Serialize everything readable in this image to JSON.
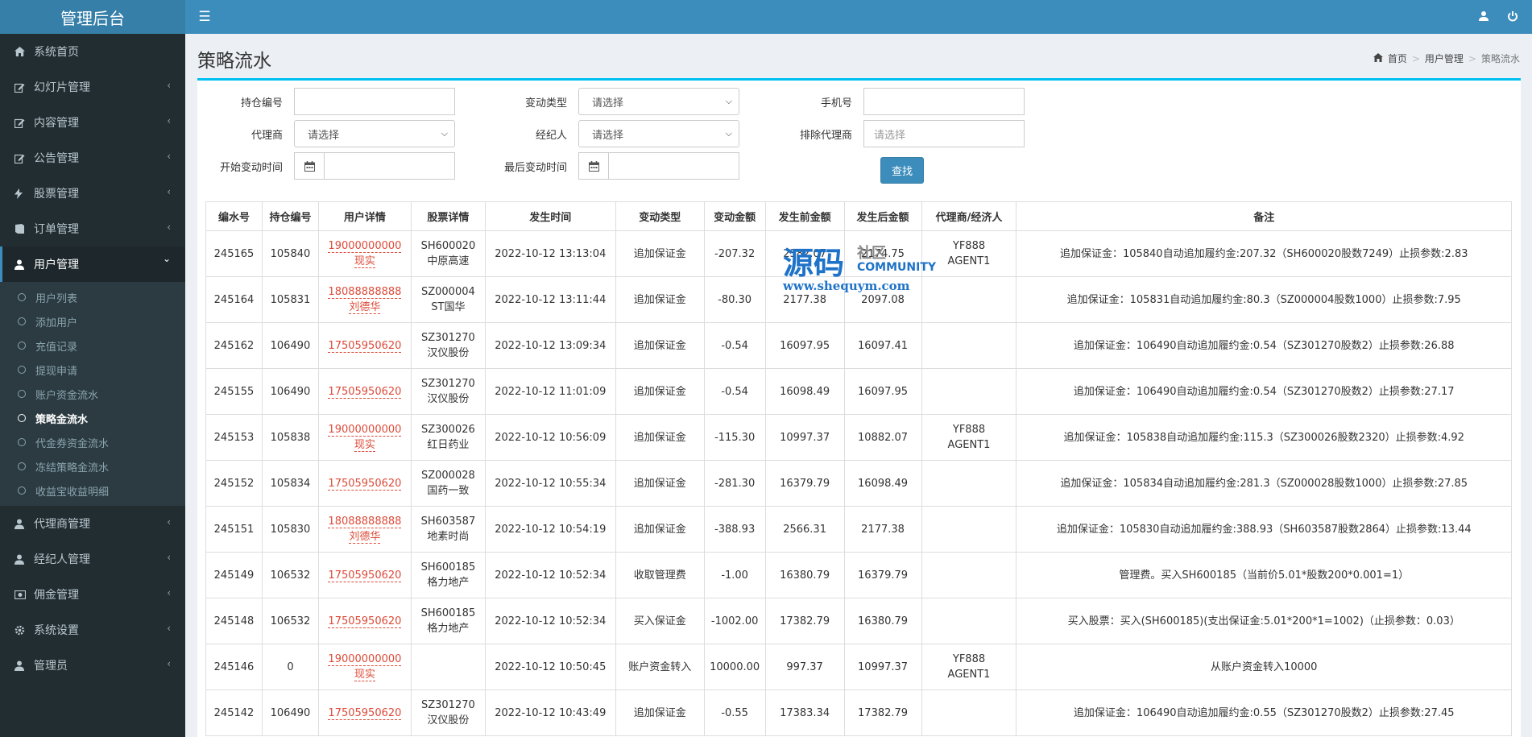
{
  "app": {
    "title": "管理后台"
  },
  "header": {
    "toggle_icon": "menu-icon",
    "user_icon": "user-icon",
    "power_icon": "power-icon"
  },
  "sidebar": {
    "items": [
      {
        "label": "系统首页",
        "icon": "home-icon",
        "has_arrow": false
      },
      {
        "label": "幻灯片管理",
        "icon": "edit-icon",
        "has_arrow": true
      },
      {
        "label": "内容管理",
        "icon": "edit-icon",
        "has_arrow": true
      },
      {
        "label": "公告管理",
        "icon": "edit-icon",
        "has_arrow": true
      },
      {
        "label": "股票管理",
        "icon": "bolt-icon",
        "has_arrow": true
      },
      {
        "label": "订单管理",
        "icon": "book-icon",
        "has_arrow": true
      },
      {
        "label": "用户管理",
        "icon": "user-icon",
        "has_arrow": true,
        "active": true
      },
      {
        "label": "代理商管理",
        "icon": "user-icon",
        "has_arrow": true
      },
      {
        "label": "经纪人管理",
        "icon": "user-icon",
        "has_arrow": true
      },
      {
        "label": "佣金管理",
        "icon": "money-icon",
        "has_arrow": true
      },
      {
        "label": "系统设置",
        "icon": "gear-icon",
        "has_arrow": true
      },
      {
        "label": "管理员",
        "icon": "user-icon",
        "has_arrow": true
      }
    ],
    "user_submenu": [
      {
        "label": "用户列表"
      },
      {
        "label": "添加用户"
      },
      {
        "label": "充值记录"
      },
      {
        "label": "提现申请"
      },
      {
        "label": "账户资金流水"
      },
      {
        "label": "策略金流水",
        "active": true
      },
      {
        "label": "代金券资金流水"
      },
      {
        "label": "冻结策略金流水"
      },
      {
        "label": "收益宝收益明细"
      }
    ]
  },
  "page": {
    "title": "策略流水",
    "breadcrumb": [
      "首页",
      "用户管理",
      "策略流水"
    ]
  },
  "filters": {
    "position_no_label": "持仓编号",
    "change_type_label": "变动类型",
    "change_type_value": "请选择",
    "phone_label": "手机号",
    "agent_label": "代理商",
    "agent_value": "请选择",
    "broker_label": "经纪人",
    "broker_value": "请选择",
    "exclude_agent_label": "排除代理商",
    "exclude_agent_placeholder": "请选择",
    "start_time_label": "开始变动时间",
    "end_time_label": "最后变动时间",
    "search_button": "查找"
  },
  "table": {
    "headers": [
      "编水号",
      "持仓编号",
      "用户详情",
      "股票详情",
      "发生时间",
      "变动类型",
      "变动金额",
      "发生前金额",
      "发生后金额",
      "代理商/经济人",
      "备注"
    ],
    "rows": [
      {
        "id": "245165",
        "pos": "105840",
        "phone": "19000000000",
        "name": "现实",
        "code": "SH600020",
        "stock": "中原高速",
        "time": "2022-10-12 13:13:04",
        "type": "追加保证金",
        "amount": "-207.32",
        "before": "2382.07",
        "after": "2174.75",
        "agent": "YF888",
        "broker": "AGENT1",
        "note": "追加保证金：105840自动追加履约金:207.32（SH600020股数7249）止损参数:2.83"
      },
      {
        "id": "245164",
        "pos": "105831",
        "phone": "18088888888",
        "name": "刘德华",
        "code": "SZ000004",
        "stock": "ST国华",
        "time": "2022-10-12 13:11:44",
        "type": "追加保证金",
        "amount": "-80.30",
        "before": "2177.38",
        "after": "2097.08",
        "agent": "",
        "broker": "",
        "note": "追加保证金：105831自动追加履约金:80.3（SZ000004股数1000）止损参数:7.95"
      },
      {
        "id": "245162",
        "pos": "106490",
        "phone": "17505950620",
        "name": "",
        "code": "SZ301270",
        "stock": "汉仪股份",
        "time": "2022-10-12 13:09:34",
        "type": "追加保证金",
        "amount": "-0.54",
        "before": "16097.95",
        "after": "16097.41",
        "agent": "",
        "broker": "",
        "note": "追加保证金：106490自动追加履约金:0.54（SZ301270股数2）止损参数:26.88"
      },
      {
        "id": "245155",
        "pos": "106490",
        "phone": "17505950620",
        "name": "",
        "code": "SZ301270",
        "stock": "汉仪股份",
        "time": "2022-10-12 11:01:09",
        "type": "追加保证金",
        "amount": "-0.54",
        "before": "16098.49",
        "after": "16097.95",
        "agent": "",
        "broker": "",
        "note": "追加保证金：106490自动追加履约金:0.54（SZ301270股数2）止损参数:27.17"
      },
      {
        "id": "245153",
        "pos": "105838",
        "phone": "19000000000",
        "name": "现实",
        "code": "SZ300026",
        "stock": "红日药业",
        "time": "2022-10-12 10:56:09",
        "type": "追加保证金",
        "amount": "-115.30",
        "before": "10997.37",
        "after": "10882.07",
        "agent": "YF888",
        "broker": "AGENT1",
        "note": "追加保证金：105838自动追加履约金:115.3（SZ300026股数2320）止损参数:4.92"
      },
      {
        "id": "245152",
        "pos": "105834",
        "phone": "17505950620",
        "name": "",
        "code": "SZ000028",
        "stock": "国药一致",
        "time": "2022-10-12 10:55:34",
        "type": "追加保证金",
        "amount": "-281.30",
        "before": "16379.79",
        "after": "16098.49",
        "agent": "",
        "broker": "",
        "note": "追加保证金：105834自动追加履约金:281.3（SZ000028股数1000）止损参数:27.85"
      },
      {
        "id": "245151",
        "pos": "105830",
        "phone": "18088888888",
        "name": "刘德华",
        "code": "SH603587",
        "stock": "地素时尚",
        "time": "2022-10-12 10:54:19",
        "type": "追加保证金",
        "amount": "-388.93",
        "before": "2566.31",
        "after": "2177.38",
        "agent": "",
        "broker": "",
        "note": "追加保证金：105830自动追加履约金:388.93（SH603587股数2864）止损参数:13.44"
      },
      {
        "id": "245149",
        "pos": "106532",
        "phone": "17505950620",
        "name": "",
        "code": "SH600185",
        "stock": "格力地产",
        "time": "2022-10-12 10:52:34",
        "type": "收取管理费",
        "amount": "-1.00",
        "before": "16380.79",
        "after": "16379.79",
        "agent": "",
        "broker": "",
        "note": "管理费。买入SH600185（当前价5.01*股数200*0.001=1）"
      },
      {
        "id": "245148",
        "pos": "106532",
        "phone": "17505950620",
        "name": "",
        "code": "SH600185",
        "stock": "格力地产",
        "time": "2022-10-12 10:52:34",
        "type": "买入保证金",
        "amount": "-1002.00",
        "before": "17382.79",
        "after": "16380.79",
        "agent": "",
        "broker": "",
        "note": "买入股票：买入(SH600185)(支出保证金:5.01*200*1=1002)（止损参数：0.03）"
      },
      {
        "id": "245146",
        "pos": "0",
        "phone": "19000000000",
        "name": "现实",
        "code": "",
        "stock": "",
        "time": "2022-10-12 10:50:45",
        "type": "账户资金转入",
        "amount": "10000.00",
        "before": "997.37",
        "after": "10997.37",
        "agent": "YF888",
        "broker": "AGENT1",
        "note": "从账户资金转入10000"
      },
      {
        "id": "245142",
        "pos": "106490",
        "phone": "17505950620",
        "name": "",
        "code": "SZ301270",
        "stock": "汉仪股份",
        "time": "2022-10-12 10:43:49",
        "type": "追加保证金",
        "amount": "-0.55",
        "before": "17383.34",
        "after": "17382.79",
        "agent": "",
        "broker": "",
        "note": "追加保证金：106490自动追加履约金:0.55（SZ301270股数2）止损参数:27.45"
      }
    ]
  },
  "watermark": {
    "big": "源码",
    "small": "社区",
    "comm": "COMMUNITY",
    "url": "www.shequym.com"
  }
}
